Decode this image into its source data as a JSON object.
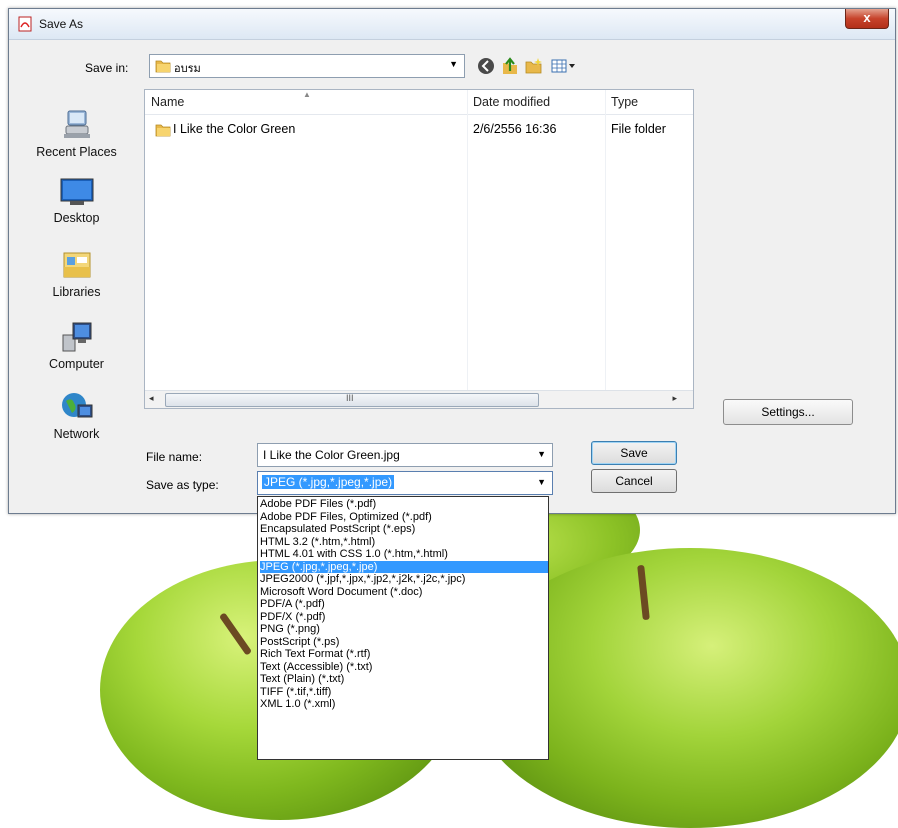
{
  "dialog": {
    "title": "Save As",
    "close_label": "x",
    "save_in_label": "Save in:",
    "save_in_value": "อบรม",
    "settings_label": "Settings...",
    "file_name_label": "File name:",
    "file_name_value": "I Like the Color Green.jpg",
    "save_as_type_label": "Save as type:",
    "save_as_type_value": "JPEG (*.jpg,*.jpeg,*.jpe)",
    "save_label": "Save",
    "cancel_label": "Cancel"
  },
  "places": [
    {
      "label": "Recent Places",
      "icon": "recent-places-icon"
    },
    {
      "label": "Desktop",
      "icon": "desktop-icon"
    },
    {
      "label": "Libraries",
      "icon": "libraries-icon"
    },
    {
      "label": "Computer",
      "icon": "computer-icon"
    },
    {
      "label": "Network",
      "icon": "network-icon"
    }
  ],
  "file_list": {
    "columns": [
      "Name",
      "Date modified",
      "Type"
    ],
    "rows": [
      {
        "name": "I Like the Color Green",
        "date": "2/6/2556 16:36",
        "type": "File folder"
      }
    ],
    "scroll_grip": "III"
  },
  "type_options": [
    "Adobe PDF Files (*.pdf)",
    "Adobe PDF Files, Optimized (*.pdf)",
    "Encapsulated PostScript (*.eps)",
    "HTML 3.2 (*.htm,*.html)",
    "HTML 4.01 with CSS 1.0 (*.htm,*.html)",
    "JPEG (*.jpg,*.jpeg,*.jpe)",
    "JPEG2000 (*.jpf,*.jpx,*.jp2,*.j2k,*.j2c,*.jpc)",
    "Microsoft Word Document (*.doc)",
    "PDF/A (*.pdf)",
    "PDF/X (*.pdf)",
    "PNG (*.png)",
    "PostScript (*.ps)",
    "Rich Text Format (*.rtf)",
    "Text (Accessible) (*.txt)",
    "Text (Plain) (*.txt)",
    "TIFF (*.tif,*.tiff)",
    "XML 1.0 (*.xml)"
  ],
  "selected_type_index": 5,
  "colors": {
    "selection": "#3399ff",
    "apple_green": "#8cc226",
    "close_red": "#c7432b"
  }
}
